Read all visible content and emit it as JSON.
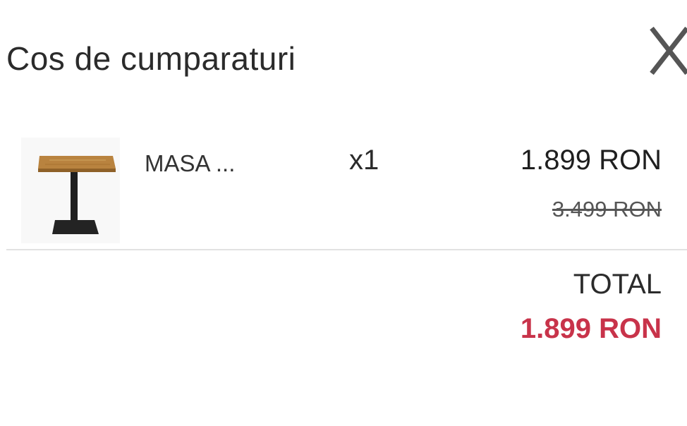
{
  "cart": {
    "title": "Cos de cumparaturi",
    "close_icon": "close-icon"
  },
  "items": [
    {
      "name": "MASA ...",
      "quantity": "x1",
      "price": "1.899 RON",
      "old_price": "3.499 RON",
      "image_icon": "table-thumbnail"
    }
  ],
  "summary": {
    "total_label": "TOTAL",
    "total_value": "1.899 RON"
  },
  "colors": {
    "total_accent": "#c8334a",
    "divider": "#e2e2e2",
    "text": "#2b2b2b"
  }
}
